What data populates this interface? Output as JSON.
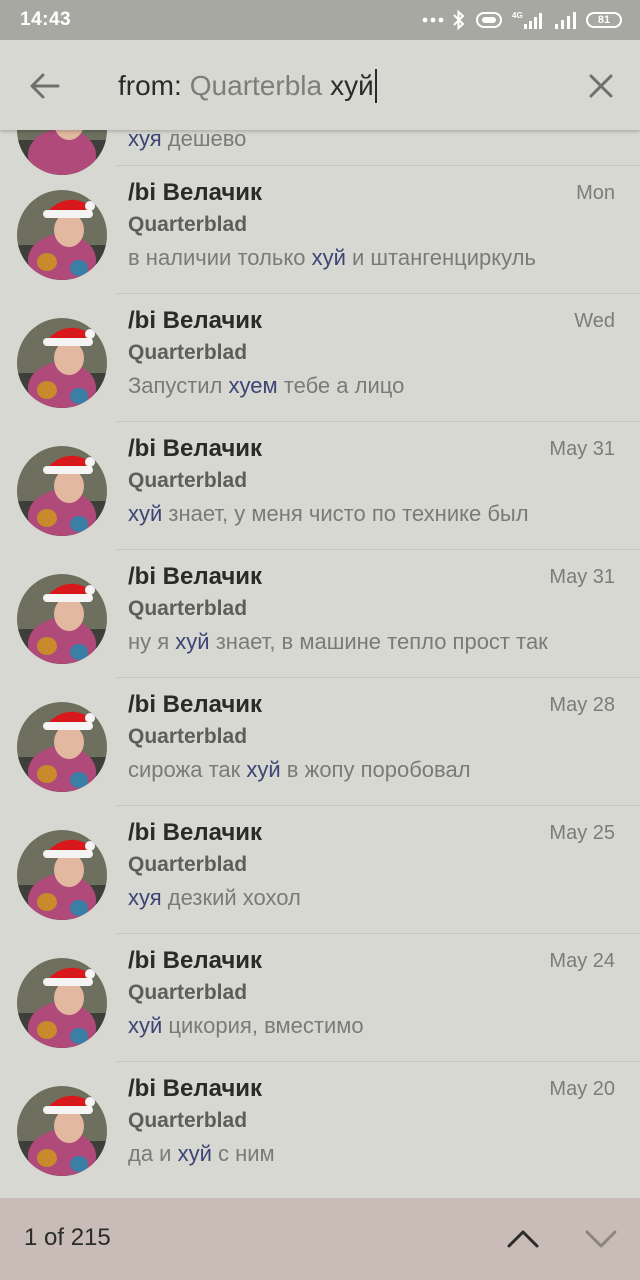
{
  "status_bar": {
    "time": "14:43",
    "network_label": "4G",
    "battery": "81",
    "icons": [
      "dots-icon",
      "bluetooth-icon",
      "vibrate-icon",
      "signal-4g-icon",
      "signal-icon",
      "battery-icon"
    ]
  },
  "search": {
    "from_label": "from:",
    "user_filter": "Quarterbla",
    "query": "хуй"
  },
  "partial_row": {
    "highlight": "хуя",
    "text": " дешево"
  },
  "results": [
    {
      "name": "/bi Велачик",
      "date": "Mon",
      "sender": "Quarterblad",
      "before": "в наличии только ",
      "highlight": "хуй",
      "after": " и штангенциркуль"
    },
    {
      "name": "/bi Велачик",
      "date": "Wed",
      "sender": "Quarterblad",
      "before": "Запустил ",
      "highlight": "хуем",
      "after": " тебе а лицо"
    },
    {
      "name": "/bi Велачик",
      "date": "May 31",
      "sender": "Quarterblad",
      "before": "",
      "highlight": "хуй",
      "after": " знает, у меня чисто по технике был"
    },
    {
      "name": "/bi Велачик",
      "date": "May 31",
      "sender": "Quarterblad",
      "before": "ну я ",
      "highlight": "хуй",
      "after": " знает, в машине тепло прост так"
    },
    {
      "name": "/bi Велачик",
      "date": "May 28",
      "sender": "Quarterblad",
      "before": "сирожа так ",
      "highlight": "хуй",
      "after": " в жопу поробовал"
    },
    {
      "name": "/bi Велачик",
      "date": "May 25",
      "sender": "Quarterblad",
      "before": "",
      "highlight": "хуя",
      "after": " дезкий хохол"
    },
    {
      "name": "/bi Велачик",
      "date": "May 24",
      "sender": "Quarterblad",
      "before": "",
      "highlight": "хуй",
      "after": " цикория, вместимо"
    },
    {
      "name": "/bi Велачик",
      "date": "May 20",
      "sender": "Quarterblad",
      "before": "да и ",
      "highlight": "хуй",
      "after": " с ним"
    }
  ],
  "footer": {
    "counter": "1 of 215"
  },
  "colors": {
    "background": "#d8d8d2",
    "status_bar": "#a8a8a3",
    "bottom_bar": "#c9bcb6",
    "highlight": "#3c4575"
  }
}
